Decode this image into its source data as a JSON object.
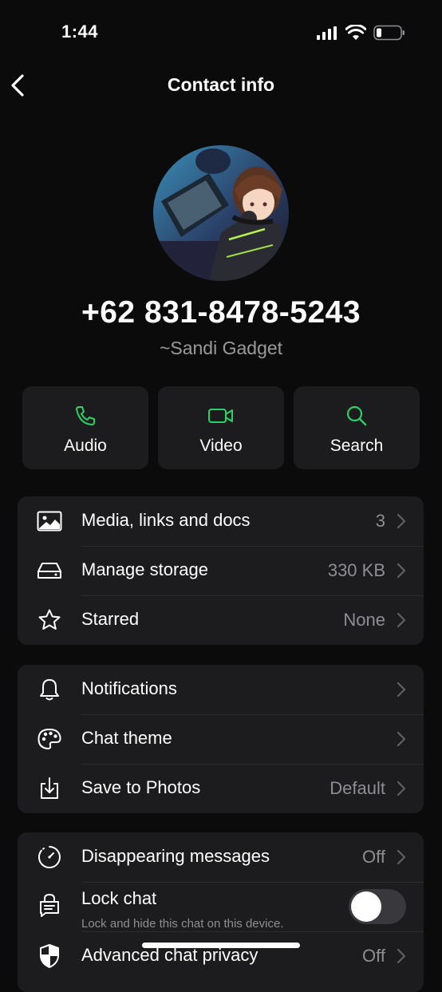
{
  "status_bar": {
    "time": "1:44"
  },
  "nav": {
    "title": "Contact info"
  },
  "contact": {
    "phone": "+62 831-8478-5243",
    "name": "~Sandi Gadget"
  },
  "actions": [
    {
      "label": "Audio",
      "icon": "phone-icon"
    },
    {
      "label": "Video",
      "icon": "video-icon"
    },
    {
      "label": "Search",
      "icon": "search-icon"
    }
  ],
  "group1": [
    {
      "label": "Media, links and docs",
      "value": "3",
      "icon": "image-icon"
    },
    {
      "label": "Manage storage",
      "value": "330 KB",
      "icon": "storage-icon"
    },
    {
      "label": "Starred",
      "value": "None",
      "icon": "star-icon"
    }
  ],
  "group2": [
    {
      "label": "Notifications",
      "value": "",
      "icon": "bell-icon"
    },
    {
      "label": "Chat theme",
      "value": "",
      "icon": "palette-icon"
    },
    {
      "label": "Save to Photos",
      "value": "Default",
      "icon": "save-download-icon"
    }
  ],
  "group3": {
    "disappearing": {
      "label": "Disappearing messages",
      "value": "Off",
      "icon": "timer-icon"
    },
    "lock_chat": {
      "label": "Lock chat",
      "sublabel": "Lock and hide this chat on this device.",
      "icon": "lock-chat-icon",
      "enabled": false
    },
    "advanced": {
      "label": "Advanced chat privacy",
      "value": "Off",
      "icon": "shield-icon"
    }
  },
  "colors": {
    "accent": "#25d366",
    "background": "#0b0b0b",
    "card": "#1c1c1e",
    "secondary_text": "#8e8e93"
  }
}
